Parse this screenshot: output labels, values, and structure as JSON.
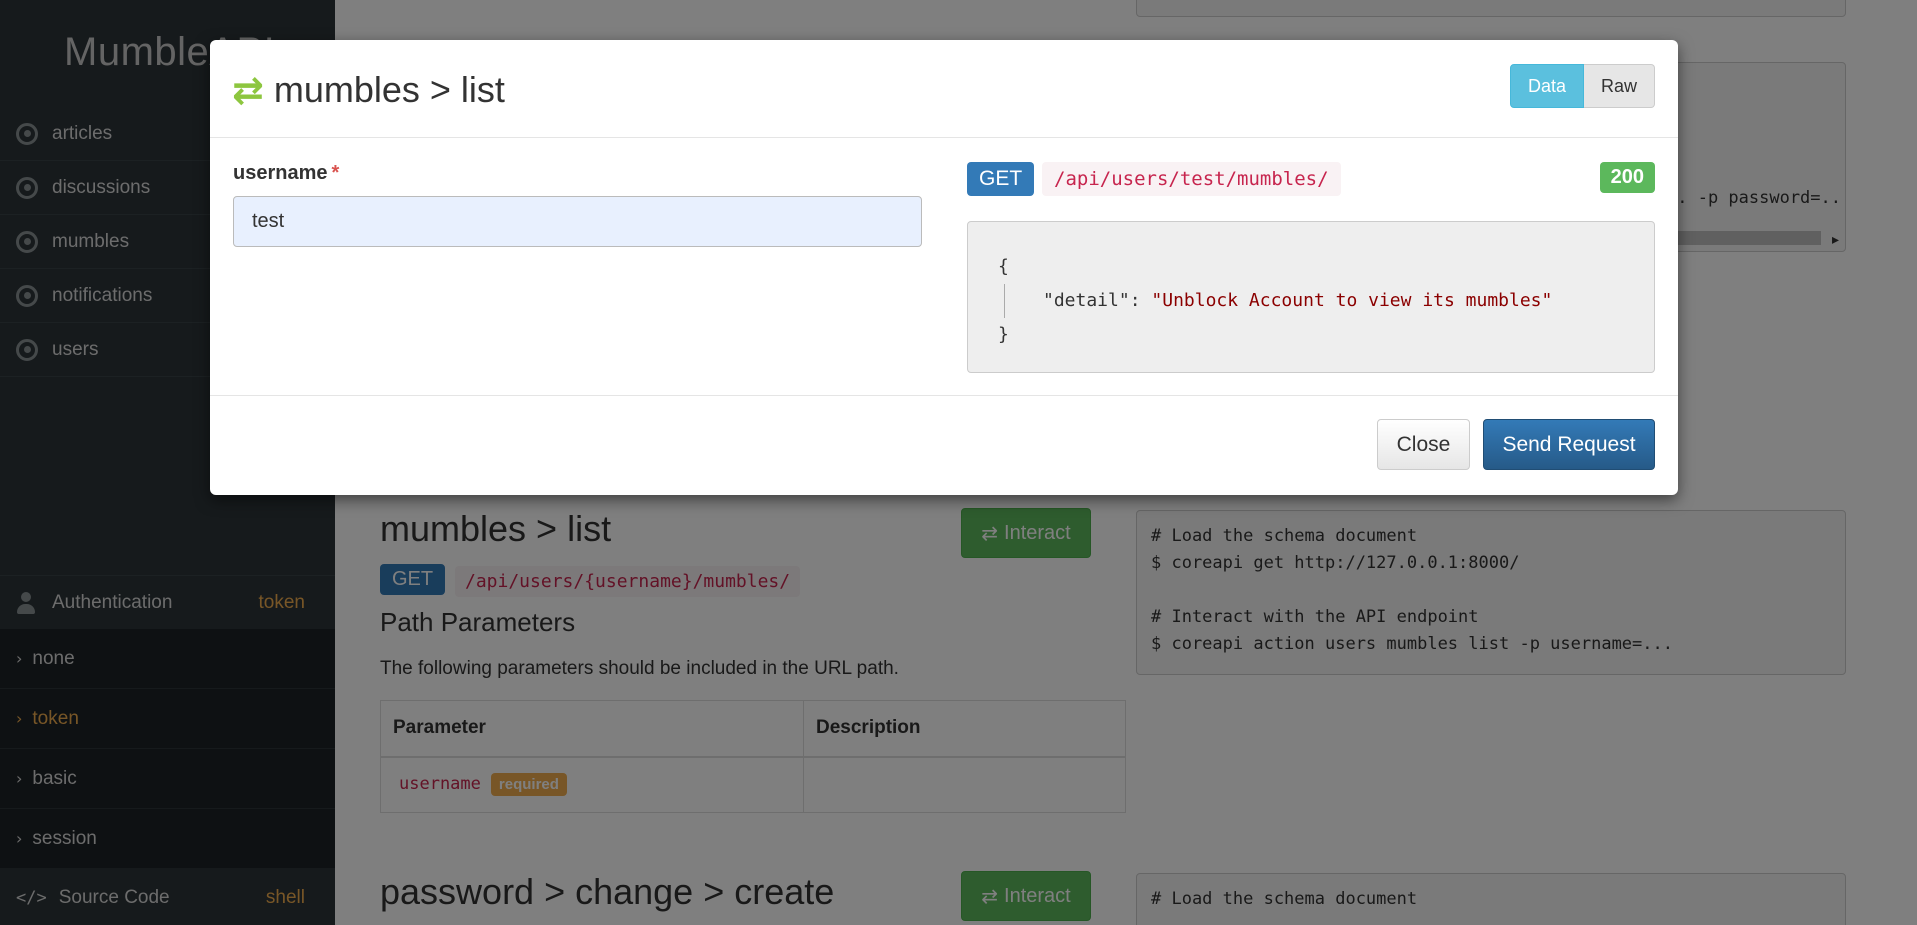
{
  "sidebar": {
    "brand": "MumbleAPI",
    "nav": [
      {
        "label": "articles"
      },
      {
        "label": "discussions"
      },
      {
        "label": "mumbles"
      },
      {
        "label": "notifications"
      },
      {
        "label": "users"
      }
    ],
    "auth": {
      "label": "Authentication",
      "current": "token",
      "options": [
        {
          "label": "none"
        },
        {
          "label": "token"
        },
        {
          "label": "basic"
        },
        {
          "label": "session"
        }
      ]
    },
    "source_code": {
      "label": "Source Code",
      "current": "shell"
    }
  },
  "background": {
    "top_code_snippet": ".. -p password=..",
    "endpoint": {
      "title": "mumbles > list",
      "interact_label": "Interact",
      "method": "GET",
      "path": "/api/users/{username}/mumbles/",
      "section_heading": "Path Parameters",
      "section_text": "The following parameters should be included in the URL path.",
      "table_headers": [
        "Parameter",
        "Description"
      ],
      "rows": [
        {
          "name": "username",
          "badge": "required",
          "description": ""
        }
      ],
      "code_lines": [
        "# Load the schema document",
        "$ coreapi get http://127.0.0.1:8000/",
        "",
        "# Interact with the API endpoint",
        "$ coreapi action users mumbles list -p username=..."
      ]
    },
    "next_endpoint": {
      "title": "password > change > create",
      "interact_label": "Interact",
      "code_line": "# Load the schema document"
    }
  },
  "modal": {
    "title": "mumbles > list",
    "toggle": {
      "data": "Data",
      "raw": "Raw"
    },
    "field": {
      "label": "username",
      "required_mark": "*",
      "value": "test"
    },
    "response": {
      "method": "GET",
      "path": "/api/users/test/mumbles/",
      "status": "200",
      "open_brace": "{",
      "key": "\"detail\"",
      "colon": ": ",
      "value": "\"Unblock Account to view its mumbles\"",
      "close_brace": "}"
    },
    "footer": {
      "close": "Close",
      "send": "Send Request"
    }
  },
  "colors": {
    "sidebar_bg": "#2c3539",
    "accent_orange": "#f0ad4e",
    "get_blue": "#337ab7",
    "status_green": "#5cb85c",
    "info_blue": "#5bc0de"
  }
}
